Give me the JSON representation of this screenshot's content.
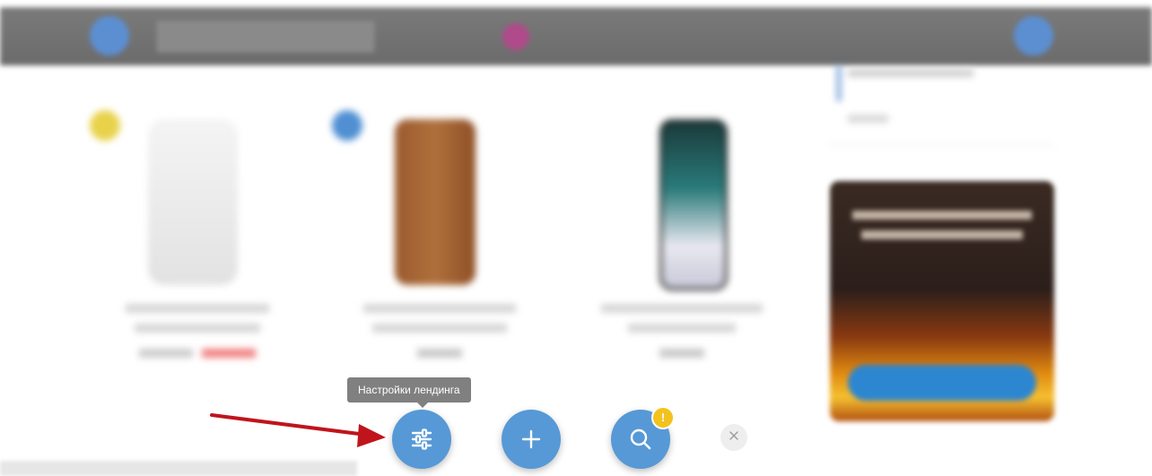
{
  "toolbar": {
    "tooltip": "Настройки лендинга",
    "notification_badge": "!",
    "buttons": [
      {
        "name": "landing-settings",
        "icon": "sliders-icon"
      },
      {
        "name": "add",
        "icon": "plus-icon"
      },
      {
        "name": "search",
        "icon": "search-icon"
      },
      {
        "name": "close",
        "icon": "close-icon"
      }
    ]
  },
  "colors": {
    "fab": "#5699d6",
    "badge": "#f4c21f",
    "arrow": "#c0141c",
    "tooltip_bg": "#808080",
    "topbar": "#707070"
  }
}
